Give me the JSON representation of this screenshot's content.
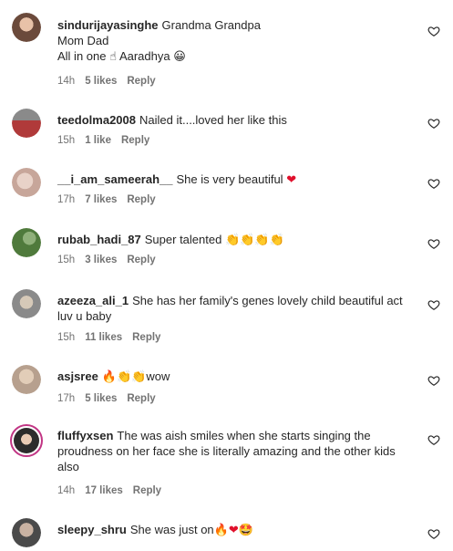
{
  "comments": [
    {
      "user": "sindurijayasinghe",
      "text": "Grandma Grandpa",
      "text2": "Mom Dad",
      "text3": "All in one",
      "text3b": "Aaradhya",
      "emojiA": "☝",
      "emojiB": "😀",
      "time": "14h",
      "likes": "5 likes",
      "reply": "Reply",
      "avatar_color": "#6b4a3b"
    },
    {
      "user": "teedolma2008",
      "text": "Nailed it....loved her like this",
      "time": "15h",
      "likes": "1 like",
      "reply": "Reply",
      "avatar_color": "#b03a3a"
    },
    {
      "user": "__i_am_sameerah__",
      "text": "She is very beautiful",
      "emoji": "❤",
      "time": "17h",
      "likes": "7 likes",
      "reply": "Reply",
      "avatar_color": "#c7a69a"
    },
    {
      "user": "rubab_hadi_87",
      "text": "Super talented",
      "emoji": "👏👏👏👏",
      "time": "15h",
      "likes": "3 likes",
      "reply": "Reply",
      "avatar_color": "#4f7a3c"
    },
    {
      "user": "azeeza_ali_1",
      "text": "She has her family's genes lovely child beautiful act luv u baby",
      "time": "15h",
      "likes": "11 likes",
      "reply": "Reply",
      "avatar_color": "#8a8a8a"
    },
    {
      "user": "asjsree",
      "emoji": "🔥👏👏",
      "text": "wow",
      "time": "17h",
      "likes": "5 likes",
      "reply": "Reply",
      "avatar_color": "#b7a08e"
    },
    {
      "user": "fluffyxsen",
      "text": "The was aish smiles when she starts singing the proudness on her face she is literally amazing and the other kids also",
      "time": "14h",
      "likes": "17 likes",
      "reply": "Reply",
      "avatar_color": "#2c2c2c"
    },
    {
      "user": "sleepy_shru",
      "text": "She was just on",
      "emoji": "🔥❤🤩",
      "avatar_color": "#4a4a4a"
    }
  ]
}
